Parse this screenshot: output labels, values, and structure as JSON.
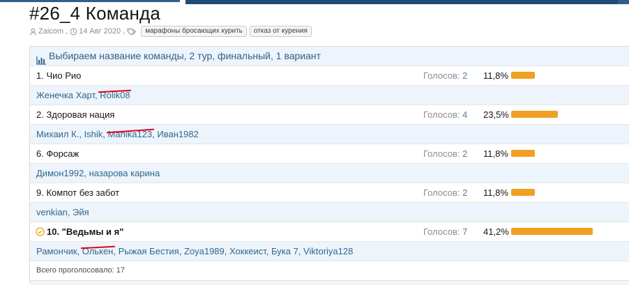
{
  "thread": {
    "title": "#26_4 Команда",
    "author": "Zaicom",
    "date": "14 Авг 2020",
    "tags": [
      "марафоны бросающих курить",
      "отказ от курения"
    ]
  },
  "poll": {
    "question": "Выбираем название команды, 2 тур, финальный, 1 вариант",
    "votes_label": "Голосов:",
    "options": [
      {
        "label": "1. Чио Рио",
        "votes": "2",
        "percent": "11,8%",
        "fraction": 0.118,
        "winner": false,
        "voters": [
          {
            "name": "Женечка Харт",
            "struck": false
          },
          {
            "name": "Rolik08",
            "struck": true
          }
        ]
      },
      {
        "label": "2. Здоровая нация",
        "votes": "4",
        "percent": "23,5%",
        "fraction": 0.235,
        "winner": false,
        "voters": [
          {
            "name": "Михаил К.",
            "struck": false
          },
          {
            "name": "Ishik",
            "struck": false
          },
          {
            "name": "Manika123",
            "struck": true
          },
          {
            "name": "Иван1982",
            "struck": false
          }
        ]
      },
      {
        "label": "6. Форсаж",
        "votes": "2",
        "percent": "11,8%",
        "fraction": 0.118,
        "winner": false,
        "voters": [
          {
            "name": "Димон1992",
            "struck": false
          },
          {
            "name": "назарова карина",
            "struck": false
          }
        ]
      },
      {
        "label": "9. Компот без забот",
        "votes": "2",
        "percent": "11,8%",
        "fraction": 0.118,
        "winner": false,
        "voters": [
          {
            "name": "venkian",
            "struck": false
          },
          {
            "name": "Эйя",
            "struck": false
          }
        ]
      },
      {
        "label": "10. \"Ведьмы и я\"",
        "votes": "7",
        "percent": "41,2%",
        "fraction": 0.412,
        "winner": true,
        "voters": [
          {
            "name": "Рамончик",
            "struck": false
          },
          {
            "name": "Олькен",
            "struck": true
          },
          {
            "name": "Рыжая Бестия",
            "struck": false
          },
          {
            "name": "Zoya1989",
            "struck": false
          },
          {
            "name": "Хоккеист",
            "struck": false
          },
          {
            "name": "Бука 7",
            "struck": false
          },
          {
            "name": "Viktoriya128",
            "struck": false
          }
        ]
      }
    ],
    "total": "Всего проголосовало: 17"
  },
  "colors": {
    "bar": "#f0a023",
    "link": "#2f6790",
    "header_bg": "#edf4fb",
    "strike": "#e0001a"
  },
  "icons": {
    "author": "user-icon",
    "date": "clock-icon",
    "tags": "tag-icon",
    "poll": "bar-chart-icon",
    "winner": "check-circle-icon"
  }
}
